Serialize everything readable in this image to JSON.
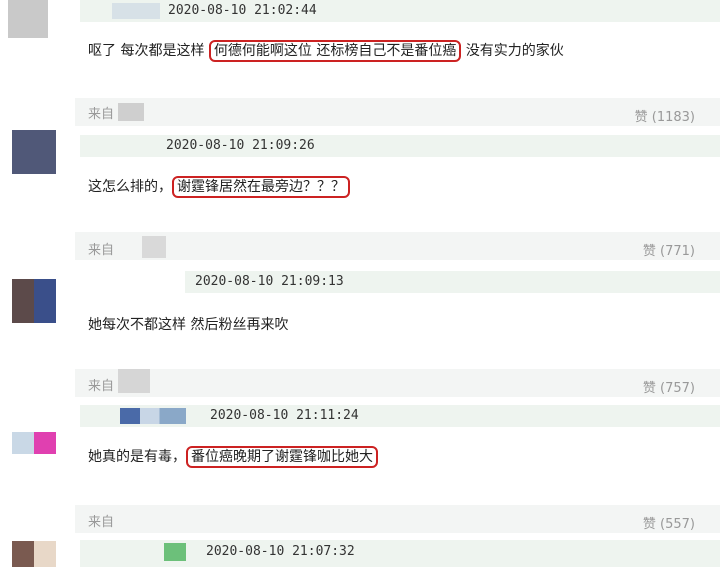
{
  "comments": [
    {
      "timestamp": "2020-08-10 21:02:44",
      "text_before": "呕了 每次都是这样",
      "text_highlight": "何德何能啊这位 还标榜自己不是番位癌",
      "text_after": "没有实力的家伙",
      "source_label": "来自",
      "likes": "赞 (1183)"
    },
    {
      "timestamp": "2020-08-10 21:09:26",
      "text_before": "这怎么排的，",
      "text_highlight": "谢霆锋居然在最旁边？？？",
      "text_after": "",
      "source_label": "来自",
      "likes": "赞 (771)"
    },
    {
      "timestamp": "2020-08-10 21:09:13",
      "text_before": "她每次不都这样 然后粉丝再来吹",
      "text_highlight": "",
      "text_after": "",
      "source_label": "来自",
      "likes": "赞 (757)"
    },
    {
      "timestamp": "2020-08-10 21:11:24",
      "text_before": "她真的是有毒，",
      "text_highlight": "番位癌晚期了谢霆锋咖比她大",
      "text_after": "",
      "source_label": "来自",
      "likes": "赞 (557)"
    },
    {
      "timestamp": "2020-08-10 21:07:32",
      "text_before": "",
      "text_highlight": "",
      "text_after": "",
      "source_label": "",
      "likes": ""
    }
  ],
  "colors": {
    "highlight_border": "#cc2222",
    "meta_band": "#eef4ef",
    "footer_band": "#f3f5f4",
    "muted_text": "#999999"
  }
}
